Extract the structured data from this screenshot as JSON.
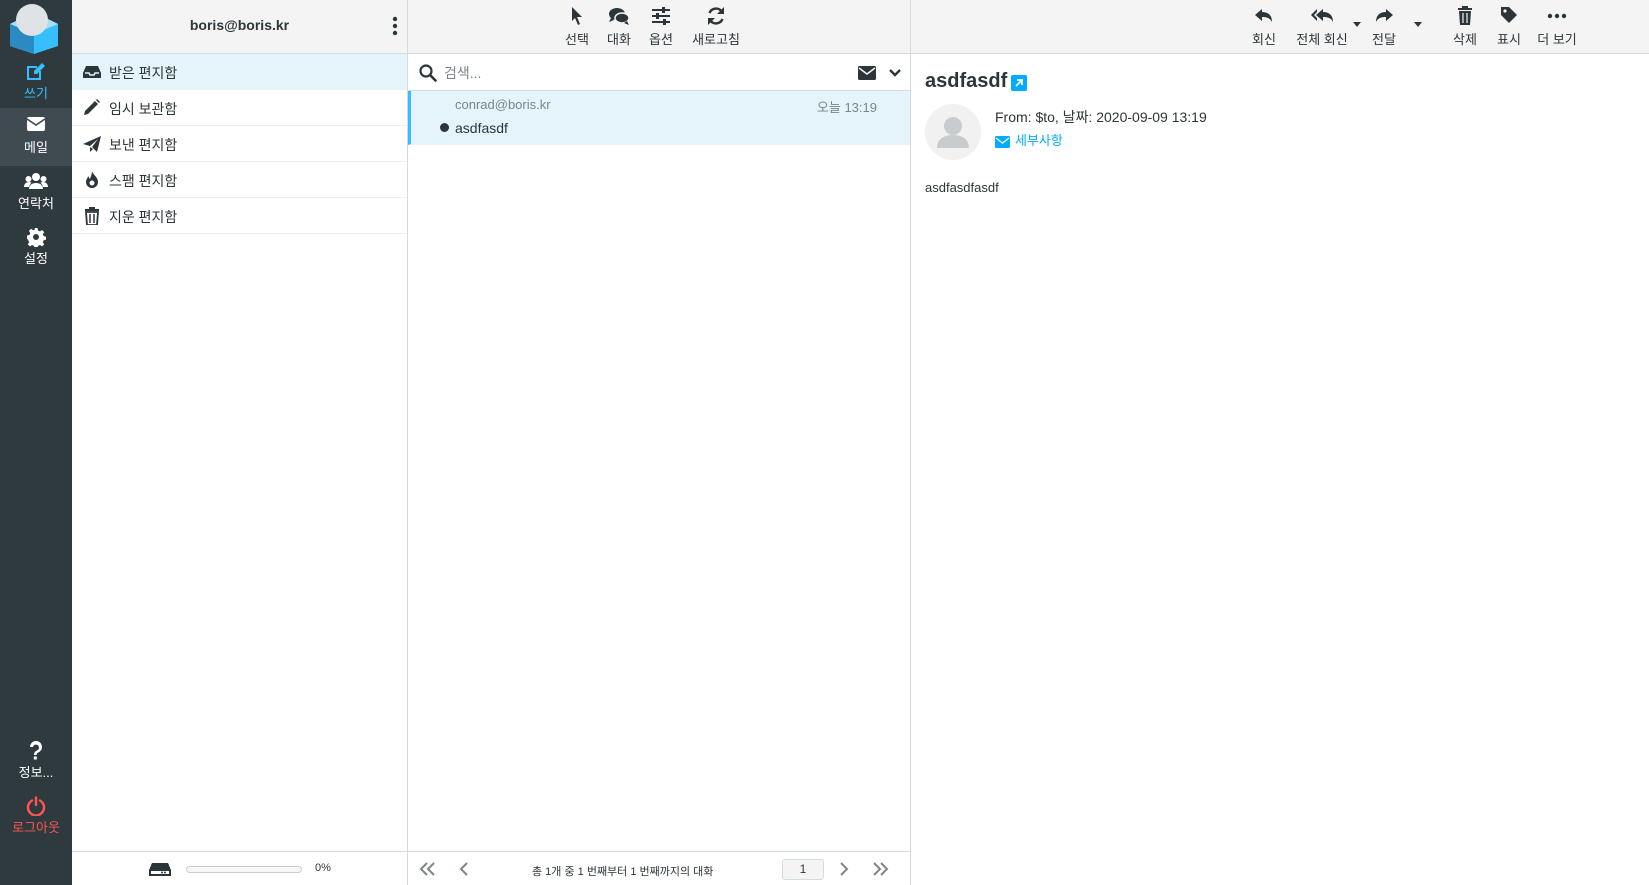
{
  "nav": {
    "items": [
      {
        "label": "쓰기",
        "icon": "compose-icon"
      },
      {
        "label": "메일",
        "icon": "envelope-icon"
      },
      {
        "label": "연락처",
        "icon": "users-icon"
      },
      {
        "label": "설정",
        "icon": "gear-icon"
      }
    ],
    "about": "정보...",
    "logout": "로그아웃"
  },
  "folders": {
    "account": "boris@boris.kr",
    "items": [
      {
        "label": "받은 편지함",
        "icon": "inbox-icon",
        "selected": true
      },
      {
        "label": "임시 보관함",
        "icon": "pencil-icon"
      },
      {
        "label": "보낸 편지함",
        "icon": "paper-plane-icon"
      },
      {
        "label": "스팸 편지함",
        "icon": "fire-icon"
      },
      {
        "label": "지운 편지함",
        "icon": "trash-icon"
      }
    ],
    "quota_text": "0%",
    "quota_fraction": 0
  },
  "list": {
    "toolbar": {
      "select": "선택",
      "threads": "대화",
      "options": "옵션",
      "refresh": "새로고침"
    },
    "search_placeholder": "검색...",
    "messages": [
      {
        "from": "conrad@boris.kr",
        "date": "오늘 13:19",
        "subject": "asdfasdf",
        "unread": true
      }
    ],
    "pagination": {
      "count_text": "총 1개 중 1 번째부터 1 번째까지의 대화",
      "page": "1"
    }
  },
  "view": {
    "toolbar": {
      "reply": "회신",
      "reply_all": "전체 회신",
      "forward": "전달",
      "delete": "삭제",
      "mark": "표시",
      "more": "더 보기"
    },
    "subject": "asdfasdf",
    "header_line": "From: $to, 날짜: 2020-09-09 13:19",
    "details": "세부사항",
    "body": "asdfasdfasdf"
  },
  "colors": {
    "accent": "#37beff",
    "nav_bg": "#2f3a3f",
    "selected_bg": "#e5f4fb",
    "logout": "#ff5552",
    "link": "#00acff"
  }
}
